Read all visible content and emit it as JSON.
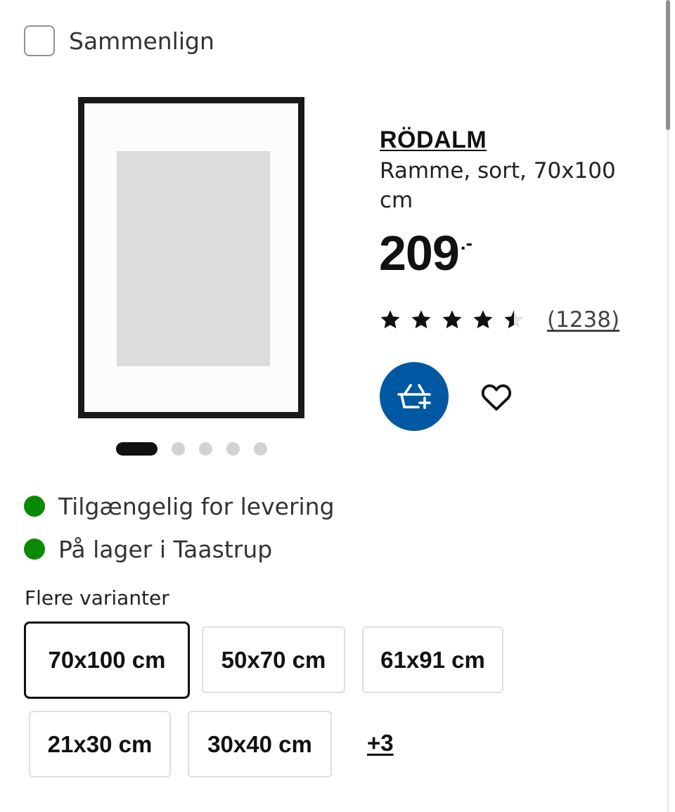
{
  "compare": {
    "label": "Sammenlign",
    "checked": false
  },
  "product": {
    "name": "RÖDALM",
    "description": "Ramme, sort, 70x100 cm",
    "price": "209",
    "price_suffix": ".-",
    "rating": 4.5,
    "rating_max": 5,
    "reviews": "(1238)",
    "image_icon": "picture-frame-image"
  },
  "carousel": {
    "count": 5,
    "active": 0
  },
  "actions": {
    "cart_icon": "add-to-cart-icon",
    "favorite_icon": "heart-icon",
    "cart_color": "#0058a3"
  },
  "availability": [
    {
      "text": "Tilgængelig for levering",
      "status_color": "#0a8a00"
    },
    {
      "text": "På lager i Taastrup",
      "status_color": "#0a8a00"
    }
  ],
  "variants": {
    "title": "Flere varianter",
    "options": [
      {
        "label": "70x100 cm",
        "selected": true
      },
      {
        "label": "50x70 cm",
        "selected": false
      },
      {
        "label": "61x91 cm",
        "selected": false
      },
      {
        "label": "21x30 cm",
        "selected": false
      },
      {
        "label": "30x40 cm",
        "selected": false
      }
    ],
    "more": "+3"
  }
}
